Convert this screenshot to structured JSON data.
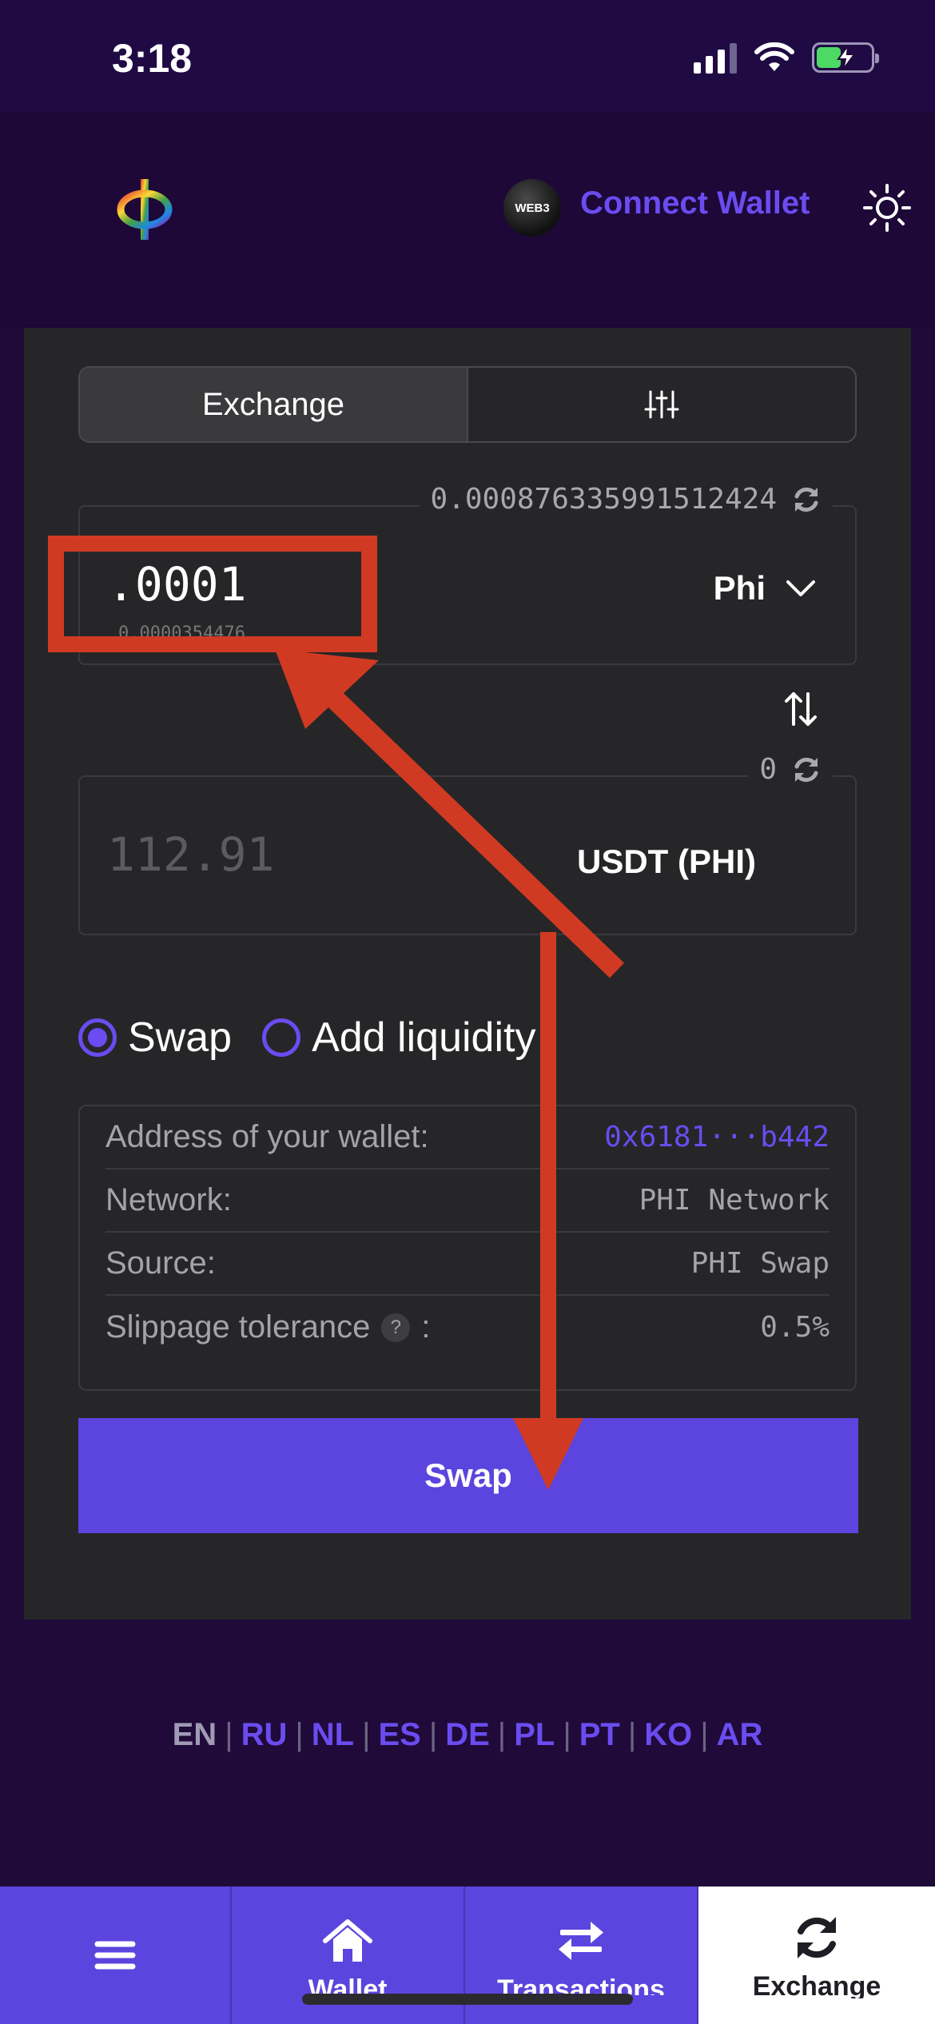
{
  "status_bar": {
    "time": "3:18"
  },
  "header": {
    "web3_badge": "WEB3",
    "connect_wallet_label": "Connect Wallet"
  },
  "tabs": {
    "exchange_label": "Exchange"
  },
  "from_field": {
    "balance": "0.000876335991512424",
    "amount": ".0001",
    "subvalue": "0.0000354476",
    "token": "Phi"
  },
  "to_field": {
    "balance": "0",
    "amount_placeholder": "112.91",
    "token": "USDT (PHI)"
  },
  "mode": {
    "swap_label": "Swap",
    "add_liquidity_label": "Add liquidity",
    "selected": "Swap"
  },
  "info": {
    "rows": [
      {
        "label": "Address of your wallet:",
        "value": "0x6181···b442"
      },
      {
        "label": "Network:",
        "value": "PHI Network"
      },
      {
        "label": "Source:",
        "value": "PHI Swap"
      },
      {
        "label": "Slippage tolerance",
        "help": "?",
        "suffix": ":",
        "value": "0.5%"
      }
    ]
  },
  "swap_button_label": "Swap",
  "languages": [
    "EN",
    "RU",
    "NL",
    "ES",
    "DE",
    "PL",
    "PT",
    "KO",
    "AR"
  ],
  "active_language": "EN",
  "bottom_nav": {
    "wallet_label": "Wallet",
    "transactions_label": "Transactions",
    "exchange_label": "Exchange"
  },
  "colors": {
    "accent": "#5b45de",
    "link": "#6a4cf0",
    "background": "#1f0a3a",
    "card": "#262628",
    "annotation": "#d13a22"
  },
  "icons": [
    "phi-logo-icon",
    "sun-icon",
    "sliders-icon",
    "refresh-icon",
    "chevron-down-icon",
    "swap-vertical-icon",
    "menu-icon",
    "home-icon",
    "transfer-icon",
    "sync-icon"
  ]
}
